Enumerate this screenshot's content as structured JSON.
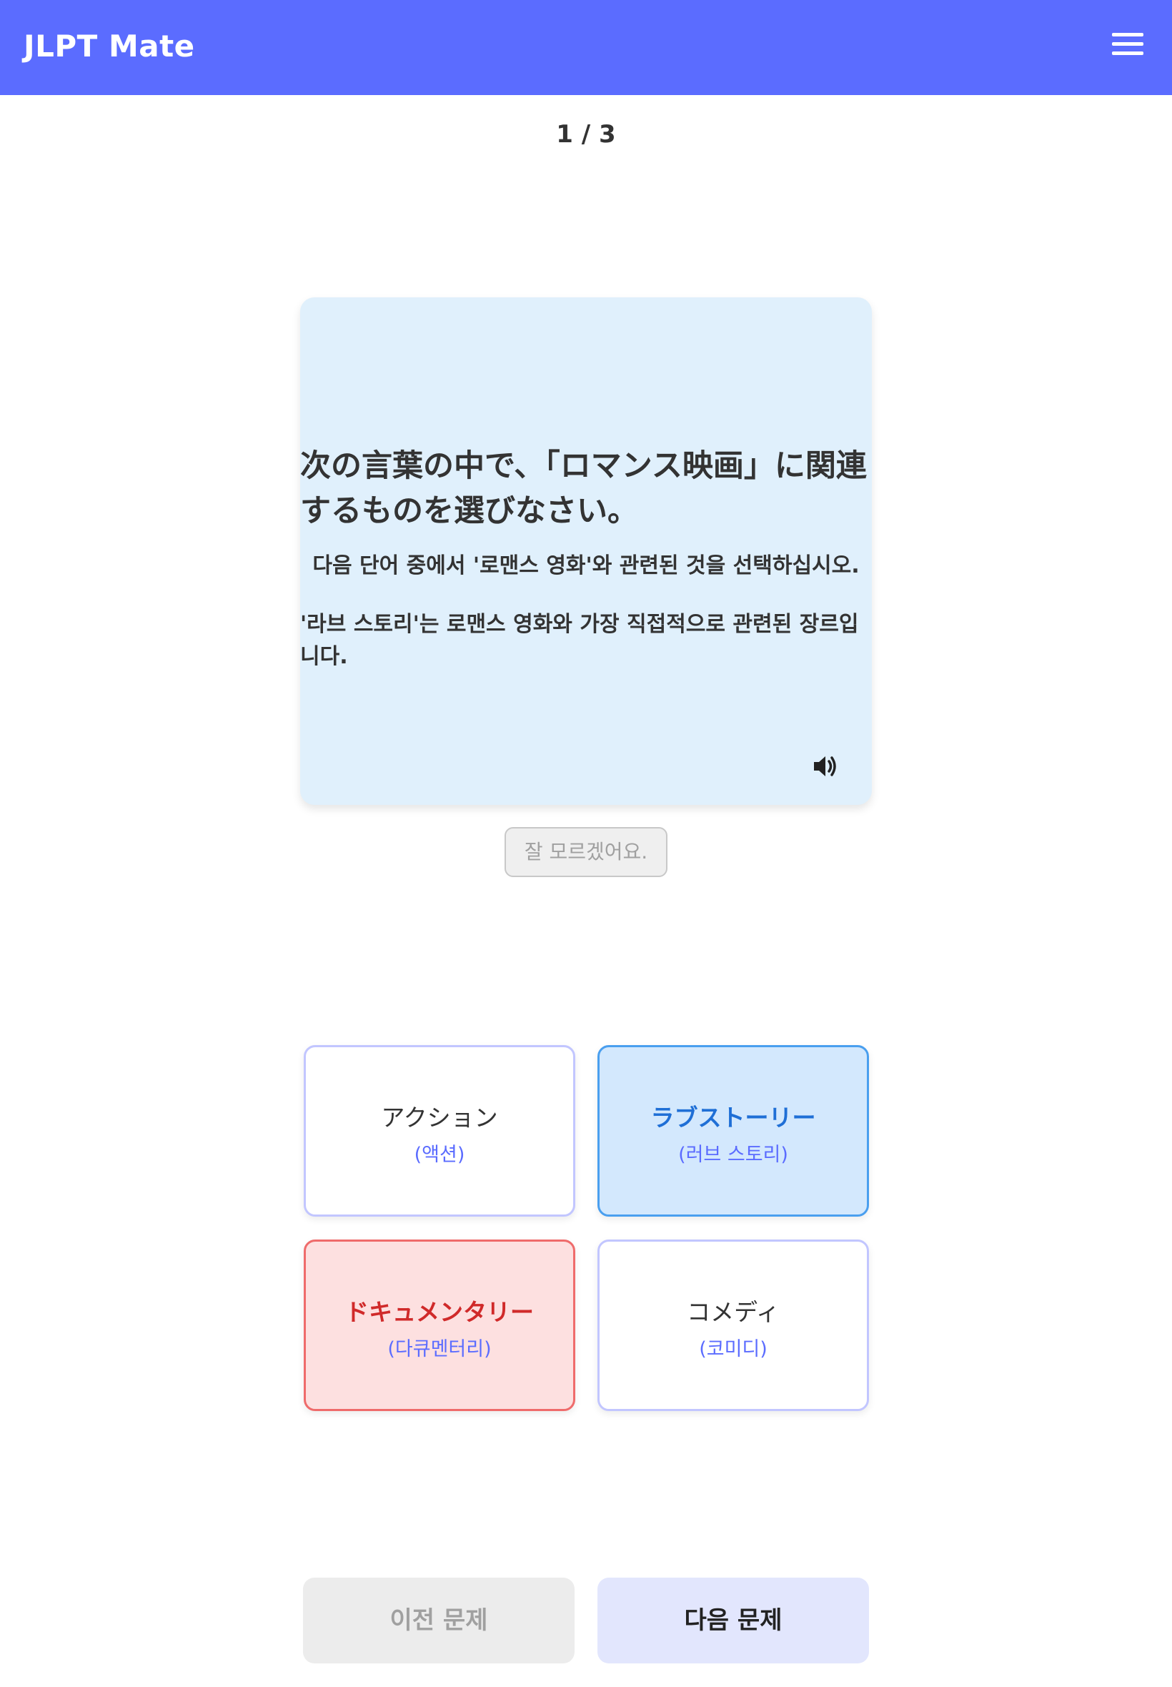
{
  "header": {
    "app_title": "JLPT Mate",
    "menu_icon": "hamburger-menu-icon",
    "color": "#5b6cff"
  },
  "progress": "1 / 3",
  "question": {
    "japanese": "次の言葉の中で、「ロマンス映画」に関連するものを選びなさい。",
    "korean": "다음 단어 중에서 '로맨스 영화'와 관련된 것을 선택하십시오.",
    "explanation": "'라브 스토리'는 로맨스 영화와 가장 직접적으로 관련된 장르입니다.",
    "audio_icon": "speaker-icon"
  },
  "dont_know_label": "잘 모르겠어요.",
  "options": [
    {
      "ja": "アクション",
      "ko": "(액션)",
      "state": "default"
    },
    {
      "ja": "ラブストーリー",
      "ko": "(러브 스토리)",
      "state": "correct"
    },
    {
      "ja": "ドキュメンタリー",
      "ko": "(다큐멘터리)",
      "state": "wrong"
    },
    {
      "ja": "コメディ",
      "ko": "(코미디)",
      "state": "default"
    }
  ],
  "nav": {
    "prev_label": "이전 문제",
    "next_label": "다음 문제"
  }
}
